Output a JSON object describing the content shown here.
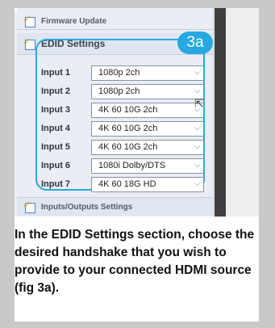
{
  "panel": {
    "firmware_label": "Firmware Update",
    "edid_label": "EDID Settings",
    "io_label": "Inputs/Outputs Settings"
  },
  "callout": {
    "badge": "3a",
    "color": "#25a9e0"
  },
  "inputs": [
    {
      "label": "Input 1",
      "value": "1080p 2ch"
    },
    {
      "label": "Input 2",
      "value": "1080p 2ch"
    },
    {
      "label": "Input 3",
      "value": "4K 60 10G 2ch"
    },
    {
      "label": "Input 4",
      "value": "4K 60 10G 2ch"
    },
    {
      "label": "Input 5",
      "value": "4K 60 10G 2ch"
    },
    {
      "label": "Input 6",
      "value": "1080i Dolby/DTS"
    },
    {
      "label": "Input 7",
      "value": "4K 60 18G HD"
    }
  ],
  "icons": {
    "section": "checked-sheet-icon",
    "dropdown": "chevron-down-icon",
    "cursor": "mouse-pointer-icon"
  },
  "caption": "In the EDID Settings section, choose the desired handshake that you wish to provide to your connected HDMI source (fig 3a)."
}
